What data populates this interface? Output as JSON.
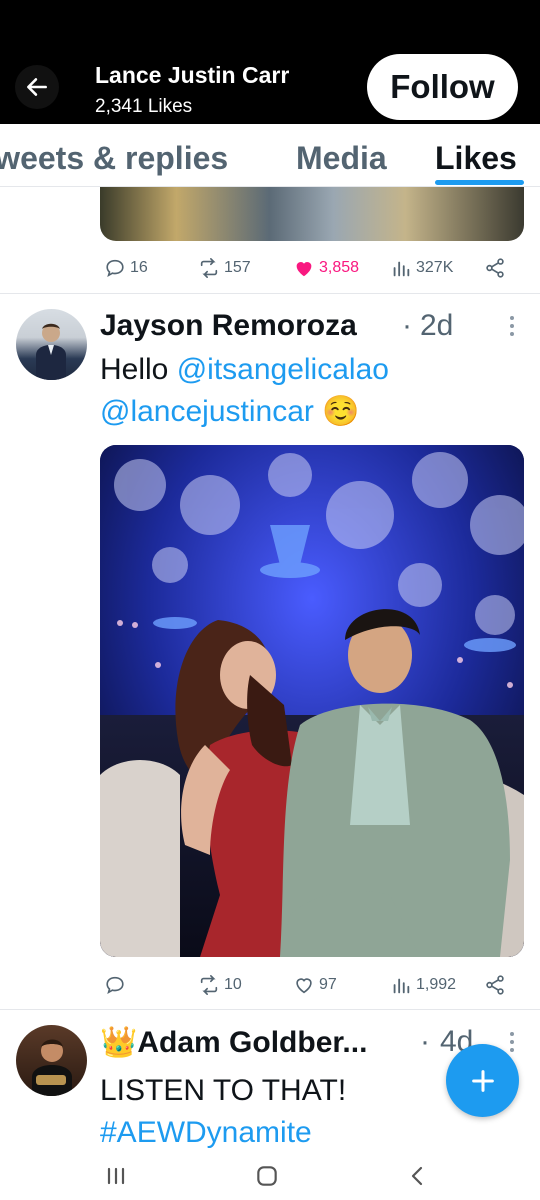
{
  "header": {
    "back_label": "Back",
    "profile_name": "Lance Justin Carr",
    "likes_count": "2,341 Likes",
    "follow_label": "Follow"
  },
  "tabs": [
    {
      "label": "Tweets & replies",
      "active": false
    },
    {
      "label": "Media",
      "active": false
    },
    {
      "label": "Likes",
      "active": true
    }
  ],
  "tweet_prev": {
    "replies": "16",
    "retweets": "157",
    "likes": "3,858",
    "views": "327K"
  },
  "tweet_main": {
    "author": "Jayson Remoroza",
    "separator": "·",
    "time": "2d",
    "text_hello": "Hello ",
    "mention1": "@itsangelicalao",
    "mention2": "@lancejustincar",
    "emoji": "☺️",
    "replies": "",
    "retweets": "10",
    "likes": "97",
    "views": "1,992"
  },
  "tweet_next": {
    "crown": "👑",
    "author": "Adam Goldber...",
    "separator": "·",
    "time": "4d",
    "text": "LISTEN TO THAT!",
    "hashtag": "#AEWDynamite"
  },
  "colors": {
    "accent": "#1d9bf0",
    "like": "#f91880",
    "muted": "#536471"
  },
  "icons": {
    "back": "arrow-left-icon",
    "reply": "reply-icon",
    "retweet": "retweet-icon",
    "like": "heart-icon",
    "views": "views-icon",
    "share": "share-icon",
    "more": "more-vertical-icon",
    "compose": "plus-icon"
  }
}
